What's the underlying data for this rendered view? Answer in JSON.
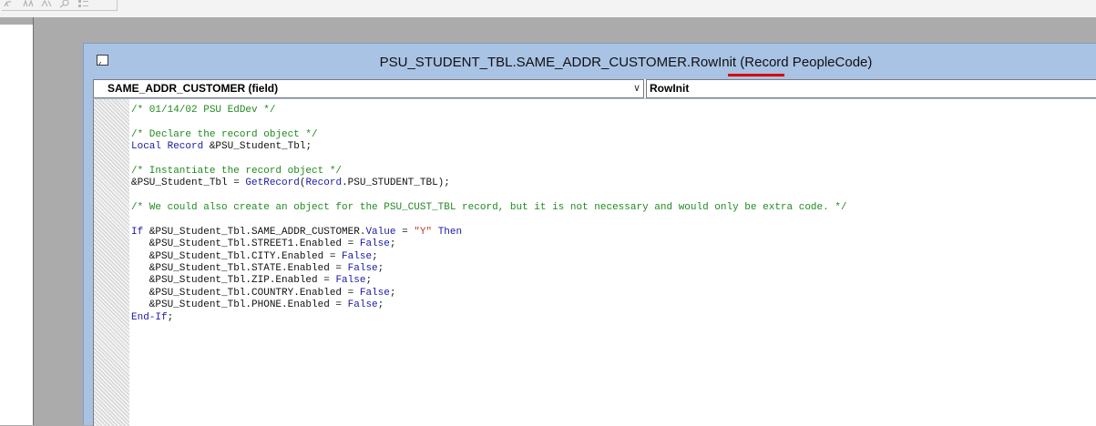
{
  "window": {
    "title_main": "PSU_STUDENT_TBL.SAME_ADDR_CUSTOMER.RowInit ",
    "title_paren_open": "(",
    "title_record": "Record",
    "title_rest": " PeopleCode)"
  },
  "selectors": {
    "field_label": "SAME_ADDR_CUSTOMER   (field)",
    "event_label": "RowInit"
  },
  "code": {
    "lines": [
      [
        {
          "t": "com",
          "v": "/* 01/14/02 PSU EdDev */"
        }
      ],
      [],
      [
        {
          "t": "com",
          "v": "/* Declare the record object */"
        }
      ],
      [
        {
          "t": "kw",
          "v": "Local Record "
        },
        {
          "t": "plain",
          "v": "&PSU_Student_Tbl;"
        }
      ],
      [],
      [
        {
          "t": "com",
          "v": "/* Instantiate the record object */"
        }
      ],
      [
        {
          "t": "plain",
          "v": "&PSU_Student_Tbl = "
        },
        {
          "t": "kw",
          "v": "GetRecord"
        },
        {
          "t": "plain",
          "v": "("
        },
        {
          "t": "kw",
          "v": "Record"
        },
        {
          "t": "plain",
          "v": ".PSU_STUDENT_TBL);"
        }
      ],
      [],
      [
        {
          "t": "com",
          "v": "/* We could also create an object for the PSU_CUST_TBL record, but it is not necessary and would only be extra code. */"
        }
      ],
      [],
      [
        {
          "t": "kw",
          "v": "If "
        },
        {
          "t": "plain",
          "v": "&PSU_Student_Tbl.SAME_ADDR_CUSTOMER."
        },
        {
          "t": "kw",
          "v": "Value"
        },
        {
          "t": "plain",
          "v": " = "
        },
        {
          "t": "str",
          "v": "\"Y\""
        },
        {
          "t": "kw",
          "v": " Then"
        }
      ],
      [
        {
          "t": "plain",
          "v": "   &PSU_Student_Tbl.STREET1.Enabled = "
        },
        {
          "t": "kw",
          "v": "False"
        },
        {
          "t": "plain",
          "v": ";"
        }
      ],
      [
        {
          "t": "plain",
          "v": "   &PSU_Student_Tbl.CITY.Enabled = "
        },
        {
          "t": "kw",
          "v": "False"
        },
        {
          "t": "plain",
          "v": ";"
        }
      ],
      [
        {
          "t": "plain",
          "v": "   &PSU_Student_Tbl.STATE.Enabled = "
        },
        {
          "t": "kw",
          "v": "False"
        },
        {
          "t": "plain",
          "v": ";"
        }
      ],
      [
        {
          "t": "plain",
          "v": "   &PSU_Student_Tbl.ZIP.Enabled = "
        },
        {
          "t": "kw",
          "v": "False"
        },
        {
          "t": "plain",
          "v": ";"
        }
      ],
      [
        {
          "t": "plain",
          "v": "   &PSU_Student_Tbl.COUNTRY.Enabled = "
        },
        {
          "t": "kw",
          "v": "False"
        },
        {
          "t": "plain",
          "v": ";"
        }
      ],
      [
        {
          "t": "plain",
          "v": "   &PSU_Student_Tbl.PHONE.Enabled = "
        },
        {
          "t": "kw",
          "v": "False"
        },
        {
          "t": "plain",
          "v": ";"
        }
      ],
      [
        {
          "t": "kw",
          "v": "End-If"
        },
        {
          "t": "plain",
          "v": ";"
        }
      ]
    ]
  },
  "colors": {
    "comment": "#1f8b1f",
    "keyword": "#1a1aa6",
    "string": "#c0392b",
    "titlebar": "#a9c3e5",
    "underline": "#d80000"
  },
  "icons": {
    "toolbar": [
      "undo-icon",
      "redo-icon",
      "indent-icon",
      "zoom-icon",
      "list-icon"
    ],
    "window": "peoplecode-window-icon"
  }
}
